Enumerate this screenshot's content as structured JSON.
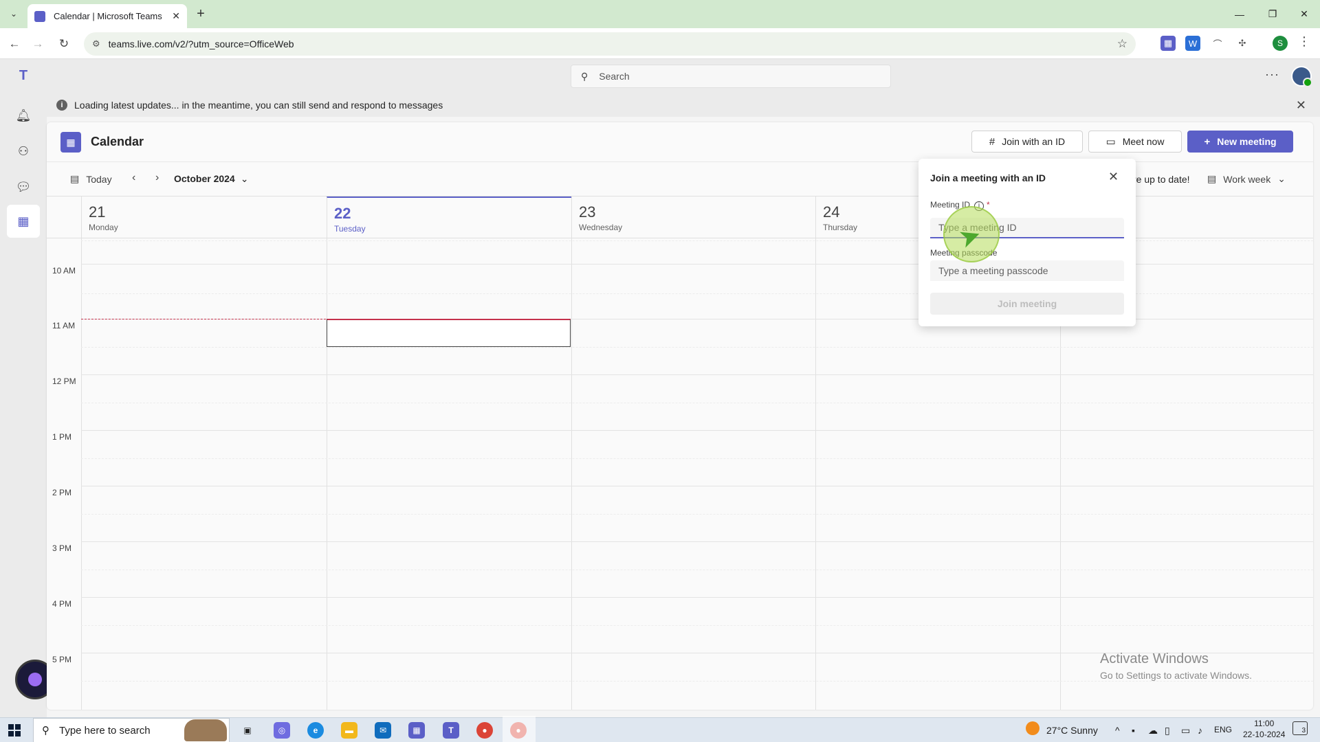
{
  "browser": {
    "tab_title": "Calendar | Microsoft Teams",
    "url": "teams.live.com/v2/?utm_source=OfficeWeb",
    "profile_initial": "S"
  },
  "teams": {
    "search_placeholder": "Search",
    "banner_text": "Loading latest updates... in the meantime, you can still send and respond to messages",
    "accent_color": "#5b5fc7"
  },
  "calendar": {
    "title": "Calendar",
    "join_with_id_label": "Join with an ID",
    "meet_now_label": "Meet now",
    "new_meeting_label": "New meeting",
    "today_label": "Today",
    "month_label": "October 2024",
    "status_text": "re up to date!",
    "view_label": "Work week",
    "days": [
      {
        "num": "21",
        "name": "Monday"
      },
      {
        "num": "22",
        "name": "Tuesday"
      },
      {
        "num": "23",
        "name": "Wednesday"
      },
      {
        "num": "24",
        "name": "Thursday"
      }
    ],
    "time_labels": [
      "10 AM",
      "11 AM",
      "12 PM",
      "1 PM",
      "2 PM",
      "3 PM",
      "4 PM",
      "5 PM"
    ]
  },
  "join_popup": {
    "title": "Join a meeting with an ID",
    "meeting_id_label": "Meeting ID",
    "meeting_id_required": "*",
    "meeting_id_placeholder": "Type a meeting ID",
    "passcode_label": "Meeting passcode",
    "passcode_placeholder": "Type a meeting passcode",
    "join_button": "Join meeting"
  },
  "watermark": {
    "line1": "Activate Windows",
    "line2": "Go to Settings to activate Windows."
  },
  "taskbar": {
    "search_placeholder": "Type here to search",
    "weather": "27°C  Sunny",
    "language": "ENG",
    "time": "11:00",
    "date": "22-10-2024",
    "notification_count": "3"
  }
}
